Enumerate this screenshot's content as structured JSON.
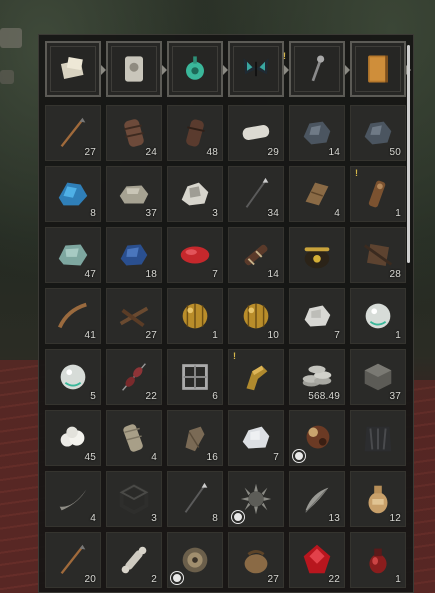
{
  "equipment": [
    {
      "icon": "parchment-note-icon",
      "marked": false
    },
    {
      "icon": "stone-tablet-icon",
      "marked": false
    },
    {
      "icon": "jade-amulet-icon",
      "marked": false
    },
    {
      "icon": "butterfly-icon",
      "marked": true
    },
    {
      "icon": "key-wand-icon",
      "marked": false
    },
    {
      "icon": "journal-book-icon",
      "marked": false
    }
  ],
  "items": [
    {
      "icon": "arrow-icon",
      "count": "27"
    },
    {
      "icon": "wrapped-bundle-icon",
      "count": "24"
    },
    {
      "icon": "leather-bundle-icon",
      "count": "48"
    },
    {
      "icon": "cloth-roll-icon",
      "count": "29"
    },
    {
      "icon": "dark-ore-icon",
      "count": "14"
    },
    {
      "icon": "dark-ore-icon",
      "count": "50"
    },
    {
      "icon": "blue-crystal-icon",
      "count": "8"
    },
    {
      "icon": "stone-chunk-icon",
      "count": "37"
    },
    {
      "icon": "white-rock-icon",
      "count": "3"
    },
    {
      "icon": "spear-icon",
      "count": "34"
    },
    {
      "icon": "wood-block-icon",
      "count": "4"
    },
    {
      "icon": "totem-icon",
      "count": "1",
      "marked": true
    },
    {
      "icon": "teal-ore-icon",
      "count": "47"
    },
    {
      "icon": "blue-ore-icon",
      "count": "18"
    },
    {
      "icon": "red-meat-icon",
      "count": "7"
    },
    {
      "icon": "bound-stick-icon",
      "count": "14"
    },
    {
      "icon": "cauldron-icon",
      "count": ""
    },
    {
      "icon": "crossbow-trap-icon",
      "count": "28"
    },
    {
      "icon": "curved-branch-icon",
      "count": "41"
    },
    {
      "icon": "twig-bundle-icon",
      "count": "27"
    },
    {
      "icon": "gold-sphere-icon",
      "count": "1"
    },
    {
      "icon": "gold-sphere-icon",
      "count": "10"
    },
    {
      "icon": "silver-lump-icon",
      "count": "7"
    },
    {
      "icon": "pearl-icon",
      "count": "1"
    },
    {
      "icon": "pearl-icon",
      "count": "5"
    },
    {
      "icon": "meat-skewer-icon",
      "count": "22"
    },
    {
      "icon": "iron-cage-icon",
      "count": "6"
    },
    {
      "icon": "gold-gauntlet-icon",
      "count": "",
      "marked": true
    },
    {
      "icon": "coin-stack-icon",
      "count": "568.49"
    },
    {
      "icon": "stone-box-icon",
      "count": "37"
    },
    {
      "icon": "cotton-ball-icon",
      "count": "45"
    },
    {
      "icon": "bandage-roll-icon",
      "count": "4"
    },
    {
      "icon": "wooden-stake-icon",
      "count": "16"
    },
    {
      "icon": "white-ore-icon",
      "count": "7"
    },
    {
      "icon": "bronze-ball-icon",
      "count": "",
      "badge": true
    },
    {
      "icon": "dark-cloak-icon",
      "count": ""
    },
    {
      "icon": "horn-icon",
      "count": "4"
    },
    {
      "icon": "iron-frame-icon",
      "count": "3"
    },
    {
      "icon": "long-arrow-icon",
      "count": "8"
    },
    {
      "icon": "spiked-mace-head-icon",
      "count": "",
      "badge": true
    },
    {
      "icon": "feather-icon",
      "count": "13"
    },
    {
      "icon": "clay-jug-icon",
      "count": "12"
    },
    {
      "icon": "arrow-icon",
      "count": "20"
    },
    {
      "icon": "bone-icon",
      "count": "2"
    },
    {
      "icon": "gear-wheel-icon",
      "count": "",
      "badge": true
    },
    {
      "icon": "leather-pouch-icon",
      "count": "27"
    },
    {
      "icon": "red-gem-icon",
      "count": "22"
    },
    {
      "icon": "red-potion-icon",
      "count": "1"
    }
  ]
}
